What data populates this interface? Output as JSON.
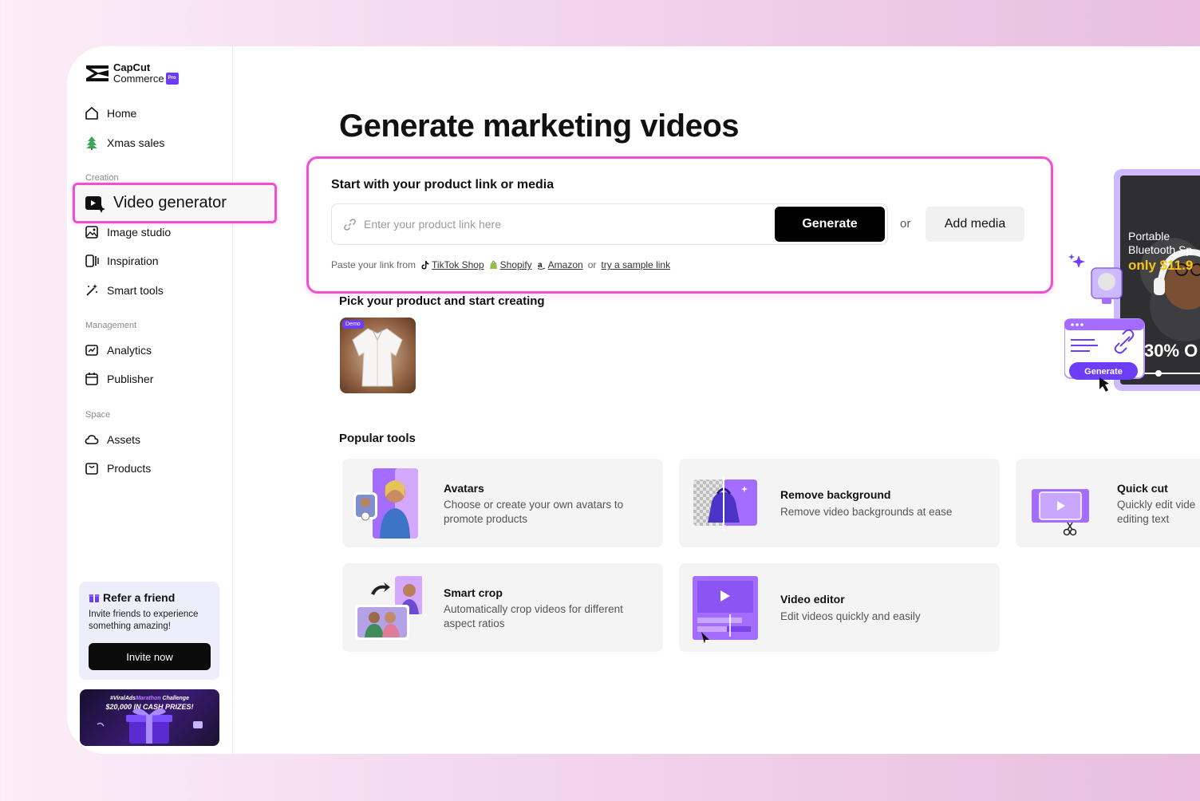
{
  "brand": {
    "line1": "CapCut",
    "line2": "Commerce",
    "badge": "Pro"
  },
  "sidebar": {
    "top_items": [
      {
        "label": "Home",
        "icon": "home-icon"
      },
      {
        "label": "Xmas sales",
        "icon": "xmas-tree-icon"
      }
    ],
    "creation_label": "Creation",
    "active_item": {
      "label": "Video generator",
      "icon": "video-generator-icon"
    },
    "creation_items": [
      {
        "label": "Image studio",
        "icon": "image-studio-icon"
      },
      {
        "label": "Inspiration",
        "icon": "inspiration-icon"
      },
      {
        "label": "Smart tools",
        "icon": "magic-wand-icon"
      }
    ],
    "management_label": "Management",
    "management_items": [
      {
        "label": "Analytics",
        "icon": "analytics-icon"
      },
      {
        "label": "Publisher",
        "icon": "calendar-icon"
      }
    ],
    "space_label": "Space",
    "space_items": [
      {
        "label": "Assets",
        "icon": "cloud-icon"
      },
      {
        "label": "Products",
        "icon": "shopping-bag-icon"
      }
    ],
    "refer": {
      "title": "Refer a friend",
      "desc": "Invite friends to experience something amazing!",
      "button": "Invite now"
    },
    "promo": {
      "line1_prefix": "#ViralAds",
      "line1_accent": "Marathon",
      "line1_suffix": " Challenge",
      "line2": "$20,000 IN CASH PRIZES!"
    }
  },
  "main": {
    "title": "Generate marketing videos",
    "card": {
      "heading": "Start with your product link or media",
      "input_placeholder": "Enter your product link here",
      "generate_button": "Generate",
      "or_text": "or",
      "add_media_button": "Add media",
      "paste_prefix": "Paste your link from",
      "sources": [
        "TikTok Shop",
        "Shopify",
        "Amazon"
      ],
      "or_join": "or",
      "sample_link": "try a sample link"
    },
    "pick_title": "Pick your product and start creating",
    "product_badge": "Demo",
    "popular_title": "Popular tools",
    "tools": [
      {
        "name": "Avatars",
        "desc": "Choose or create your own avatars to promote products"
      },
      {
        "name": "Remove background",
        "desc": "Remove video backgrounds at ease"
      },
      {
        "name": "Quick cut",
        "desc": "Quickly edit vide editing text"
      },
      {
        "name": "Smart crop",
        "desc": "Automatically crop videos for different aspect ratios"
      },
      {
        "name": "Video editor",
        "desc": "Edit videos quickly and easily"
      }
    ],
    "hero": {
      "line1": "Portable",
      "line2": "Bluetooth Sp",
      "price": "only $11.9",
      "discount": "30% O",
      "button": "Generate"
    }
  },
  "colors": {
    "accent": "#6b3df5",
    "highlight": "#ef4fd0",
    "primary_button": "#000000"
  }
}
